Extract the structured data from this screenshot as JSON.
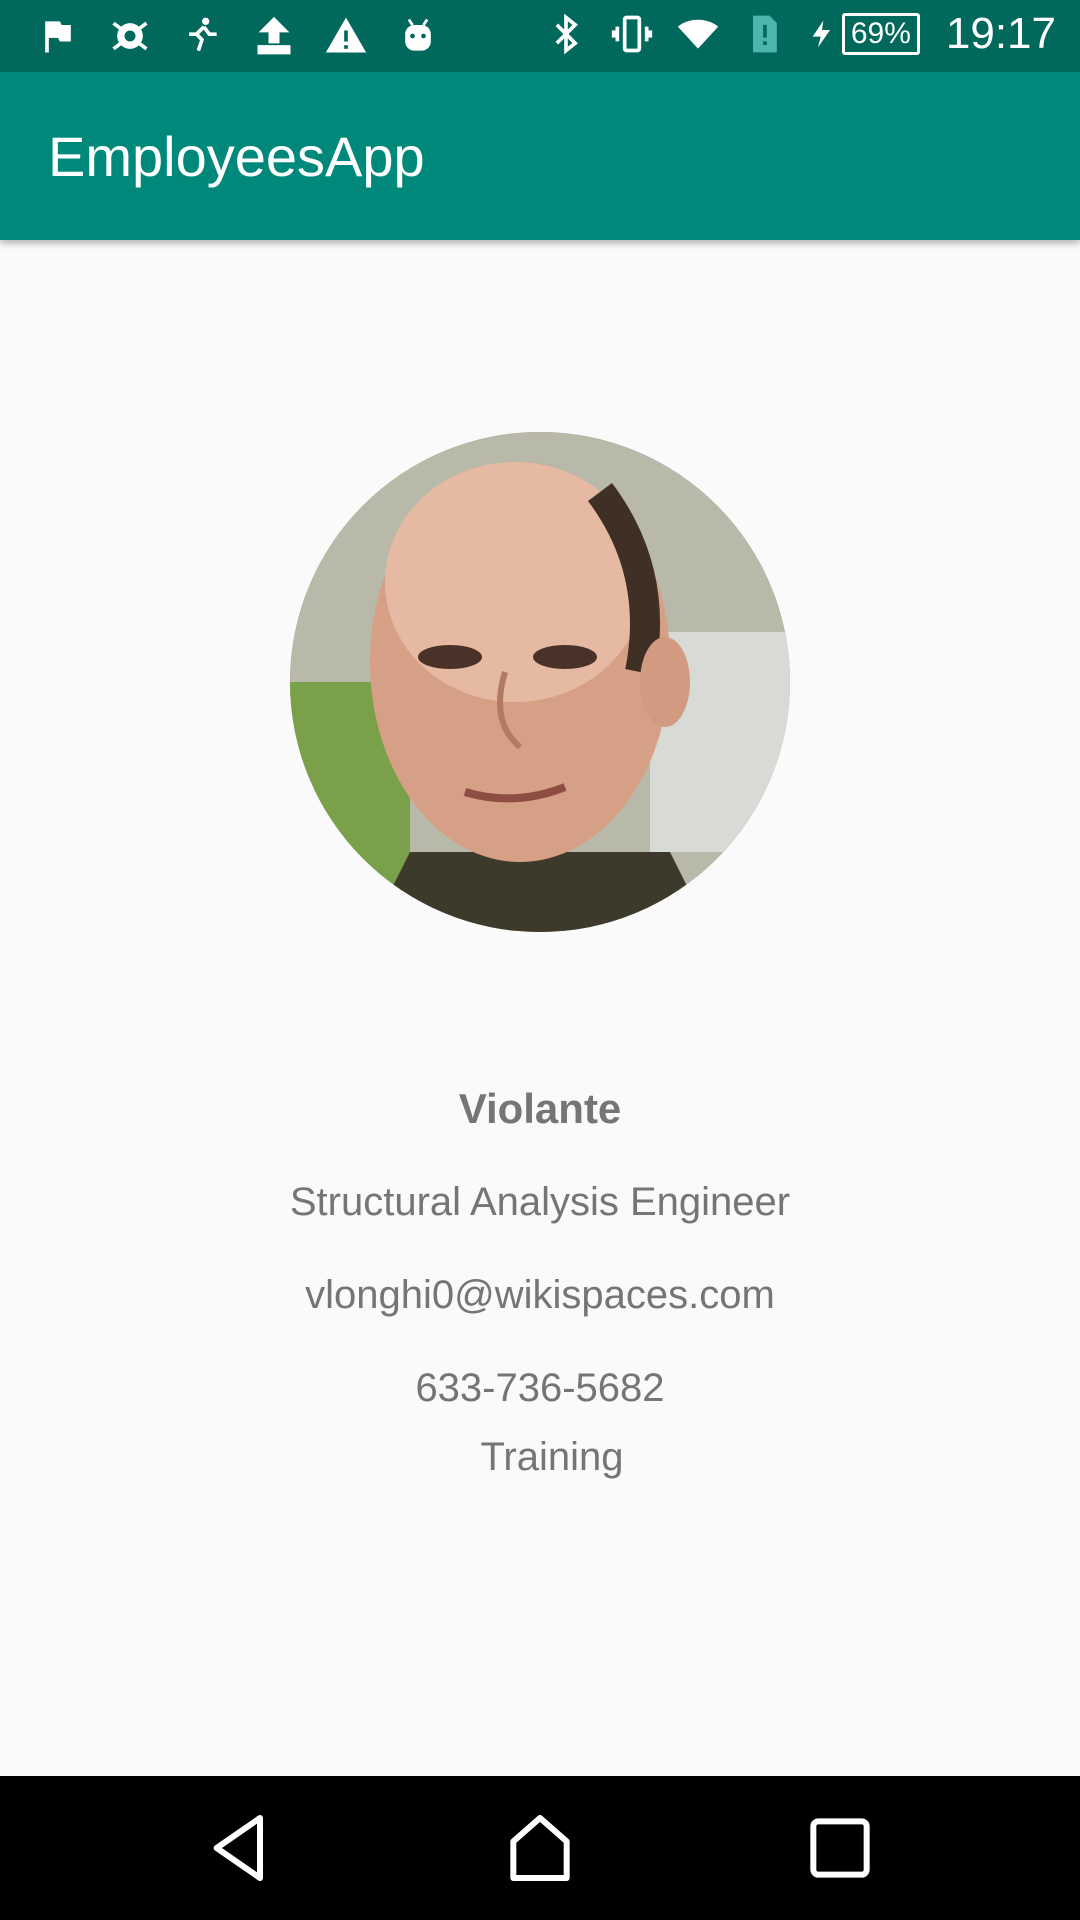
{
  "status_bar": {
    "left_icons": [
      "flag-icon",
      "bug-icon",
      "runner-icon",
      "upload-icon",
      "warning-icon",
      "android-icon"
    ],
    "right_icons": [
      "bluetooth-icon",
      "vibrate-icon",
      "wifi-icon",
      "sim-alert-icon",
      "charging-icon"
    ],
    "battery_percent": "69%",
    "time": "19:17"
  },
  "app_bar": {
    "title": "EmployeesApp"
  },
  "employee": {
    "name": "Violante",
    "job_title": "Structural Analysis Engineer",
    "email": "vlonghi0@wikispaces.com",
    "phone": "633-736-5682",
    "department": "Training"
  },
  "nav_bar": {
    "buttons": [
      "back-icon",
      "home-icon",
      "recents-icon"
    ]
  },
  "colors": {
    "status_bar": "#00695c",
    "app_bar": "#00897b",
    "background": "#fafafa",
    "text": "#757575"
  }
}
